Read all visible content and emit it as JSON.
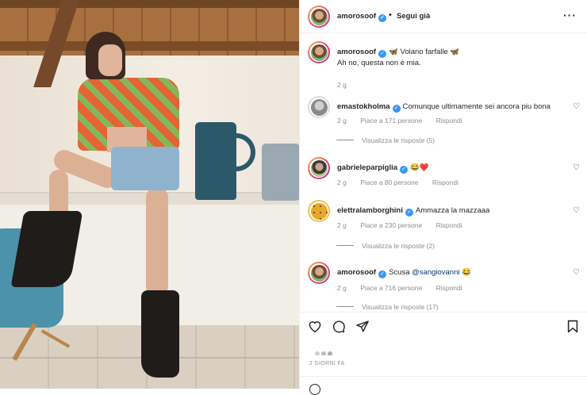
{
  "post": {
    "username": "amorosoof",
    "follow_label": "Segui già",
    "caption": "🦋 Volano farfalle 🦋",
    "caption_line2": "Ah no, questa non è mia.",
    "caption_time": "2 g"
  },
  "comments": [
    {
      "user": "emastokholma",
      "text": "Comunque ultimamente sei ancora piu bona",
      "time": "2 g",
      "likes": "Piace a 171 persone",
      "reply": "Rispondi",
      "replies": "Visualizza le risposte (5)"
    },
    {
      "user": "gabrieleparpiglia",
      "text": "😂❤️",
      "time": "2 g",
      "likes": "Piace a 80 persone",
      "reply": "Rispondi"
    },
    {
      "user": "elettralamborghini",
      "text": "Ammazza la mazzaaa",
      "time": "2 g",
      "likes": "Piace a 230 persone",
      "reply": "Rispondi",
      "replies": "Visualizza le risposte (2)"
    },
    {
      "user": "amorosoof",
      "text_prefix": "Scusa ",
      "mention": "@sangiovanni",
      "text_suffix": " 😂",
      "time": "2 g",
      "likes": "Piace a 716 persone",
      "reply": "Rispondi",
      "replies": "Visualizza le risposte (17)"
    }
  ],
  "footer": {
    "date": "2 GIORNI FA"
  },
  "icons": {
    "more": "more-icon",
    "like": "heart-icon",
    "comment": "comment-icon",
    "share": "share-icon",
    "save": "bookmark-icon",
    "verified": "verified-icon"
  }
}
